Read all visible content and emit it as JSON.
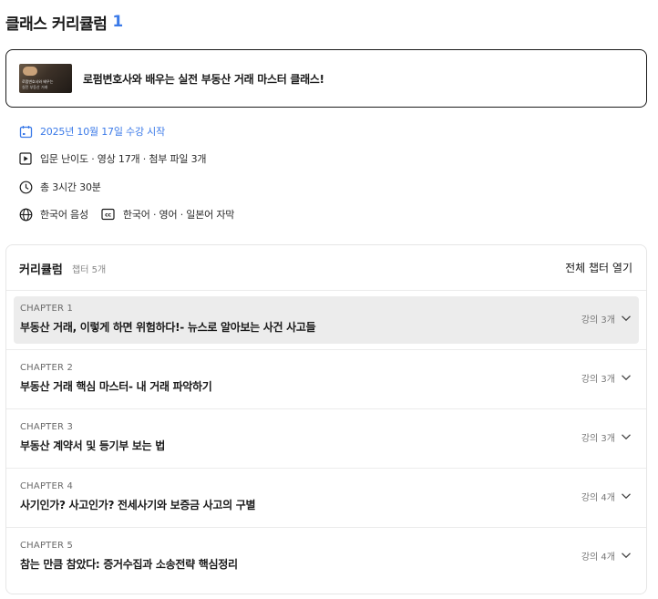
{
  "header": {
    "title": "클래스 커리큘럼",
    "count": "1"
  },
  "class_card": {
    "thumbnail_line1": "로펌변호사와 배우는",
    "thumbnail_line2": "실전 부동산 거래",
    "title": "로펌변호사와 배우는 실전 부동산 거래 마스터 클래스!"
  },
  "info": {
    "start_date": "2025년 10월 17일 수강 시작",
    "level_media": "입문 난이도 · 영상 17개 · 첨부 파일 3개",
    "duration": "총 3시간 30분",
    "audio": "한국어 음성",
    "subtitles": "한국어 · 영어 · 일본어 자막"
  },
  "curriculum": {
    "title": "커리큘럼",
    "chapter_count": "챕터 5개",
    "open_all": "전체 챕터 열기",
    "chapters": [
      {
        "label": "CHAPTER 1",
        "title": "부동산 거래, 이렇게 하면 위험하다!- 뉴스로 알아보는 사건 사고들",
        "lectures": "강의 3개"
      },
      {
        "label": "CHAPTER 2",
        "title": "부동산 거래 핵심 마스터- 내 거래 파악하기",
        "lectures": "강의 3개"
      },
      {
        "label": "CHAPTER 3",
        "title": "부동산 계약서 및 등기부 보는 법",
        "lectures": "강의 3개"
      },
      {
        "label": "CHAPTER 4",
        "title": "사기인가? 사고인가? 전세사기와 보증금 사고의 구별",
        "lectures": "강의 4개"
      },
      {
        "label": "CHAPTER 5",
        "title": "참는 만큼 참았다: 증거수집과 소송전략 핵심정리",
        "lectures": "강의 4개"
      }
    ]
  },
  "colors": {
    "accent": "#3b7ae8",
    "highlight": "#ececec"
  },
  "icons": [
    "calendar-icon",
    "play-icon",
    "clock-icon",
    "globe-icon",
    "cc-icon",
    "chevron-down-icon"
  ]
}
